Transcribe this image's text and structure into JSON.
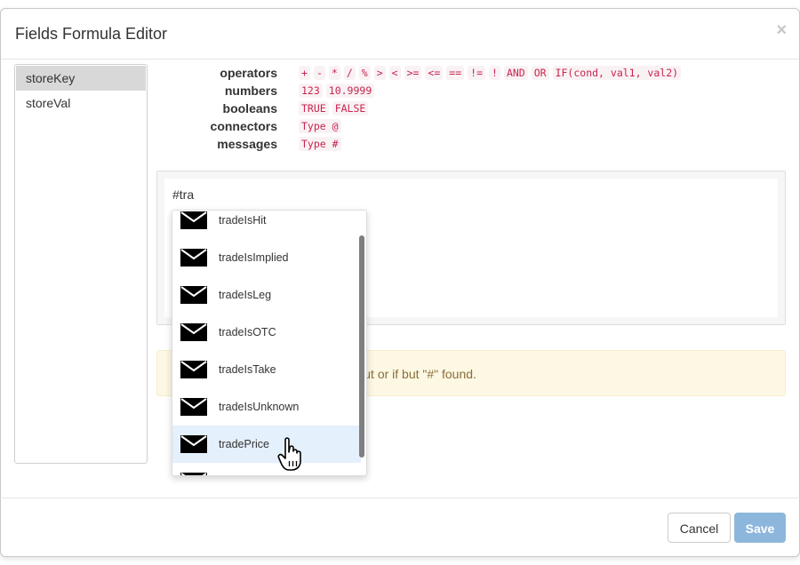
{
  "dialog": {
    "title": "Fields Formula Editor",
    "close_label": "×"
  },
  "fields": [
    {
      "label": "storeKey",
      "active": true
    },
    {
      "label": "storeVal",
      "active": false
    }
  ],
  "syntax": {
    "operators": {
      "label": "operators",
      "tokens": [
        "+",
        "-",
        "*",
        "/",
        "%",
        ">",
        "<",
        ">=",
        "<=",
        "==",
        "!=",
        "!",
        "AND",
        "OR",
        "IF(cond, val1, val2)"
      ]
    },
    "numbers": {
      "label": "numbers",
      "tokens": [
        "123",
        "10.9999"
      ]
    },
    "booleans": {
      "label": "booleans",
      "tokens": [
        "TRUE",
        "FALSE"
      ]
    },
    "connectors": {
      "label": "connectors",
      "tokens": [
        "Type @"
      ]
    },
    "messages": {
      "label": "messages",
      "tokens": [
        "Type #"
      ]
    }
  },
  "editor": {
    "value": "#tra"
  },
  "warning": {
    "visible_text": "of input or if but \"#\" found."
  },
  "autocomplete": {
    "items": [
      "tradeIsHit",
      "tradeIsImplied",
      "tradeIsLeg",
      "tradeIsOTC",
      "tradeIsTake",
      "tradeIsUnknown",
      "tradePrice",
      ""
    ],
    "hovered": "tradePrice",
    "icon": "mail-icon"
  },
  "footer": {
    "cancel_label": "Cancel",
    "save_label": "Save"
  },
  "colors": {
    "token_text": "#c7254e",
    "token_bg": "#f9f2f4",
    "warning_bg": "#fcf8e3",
    "warning_text": "#8a6d3b",
    "save_bg": "#8db6dc",
    "hover_bg": "#e4f0fb",
    "active_field_bg": "#d8d8d8"
  }
}
